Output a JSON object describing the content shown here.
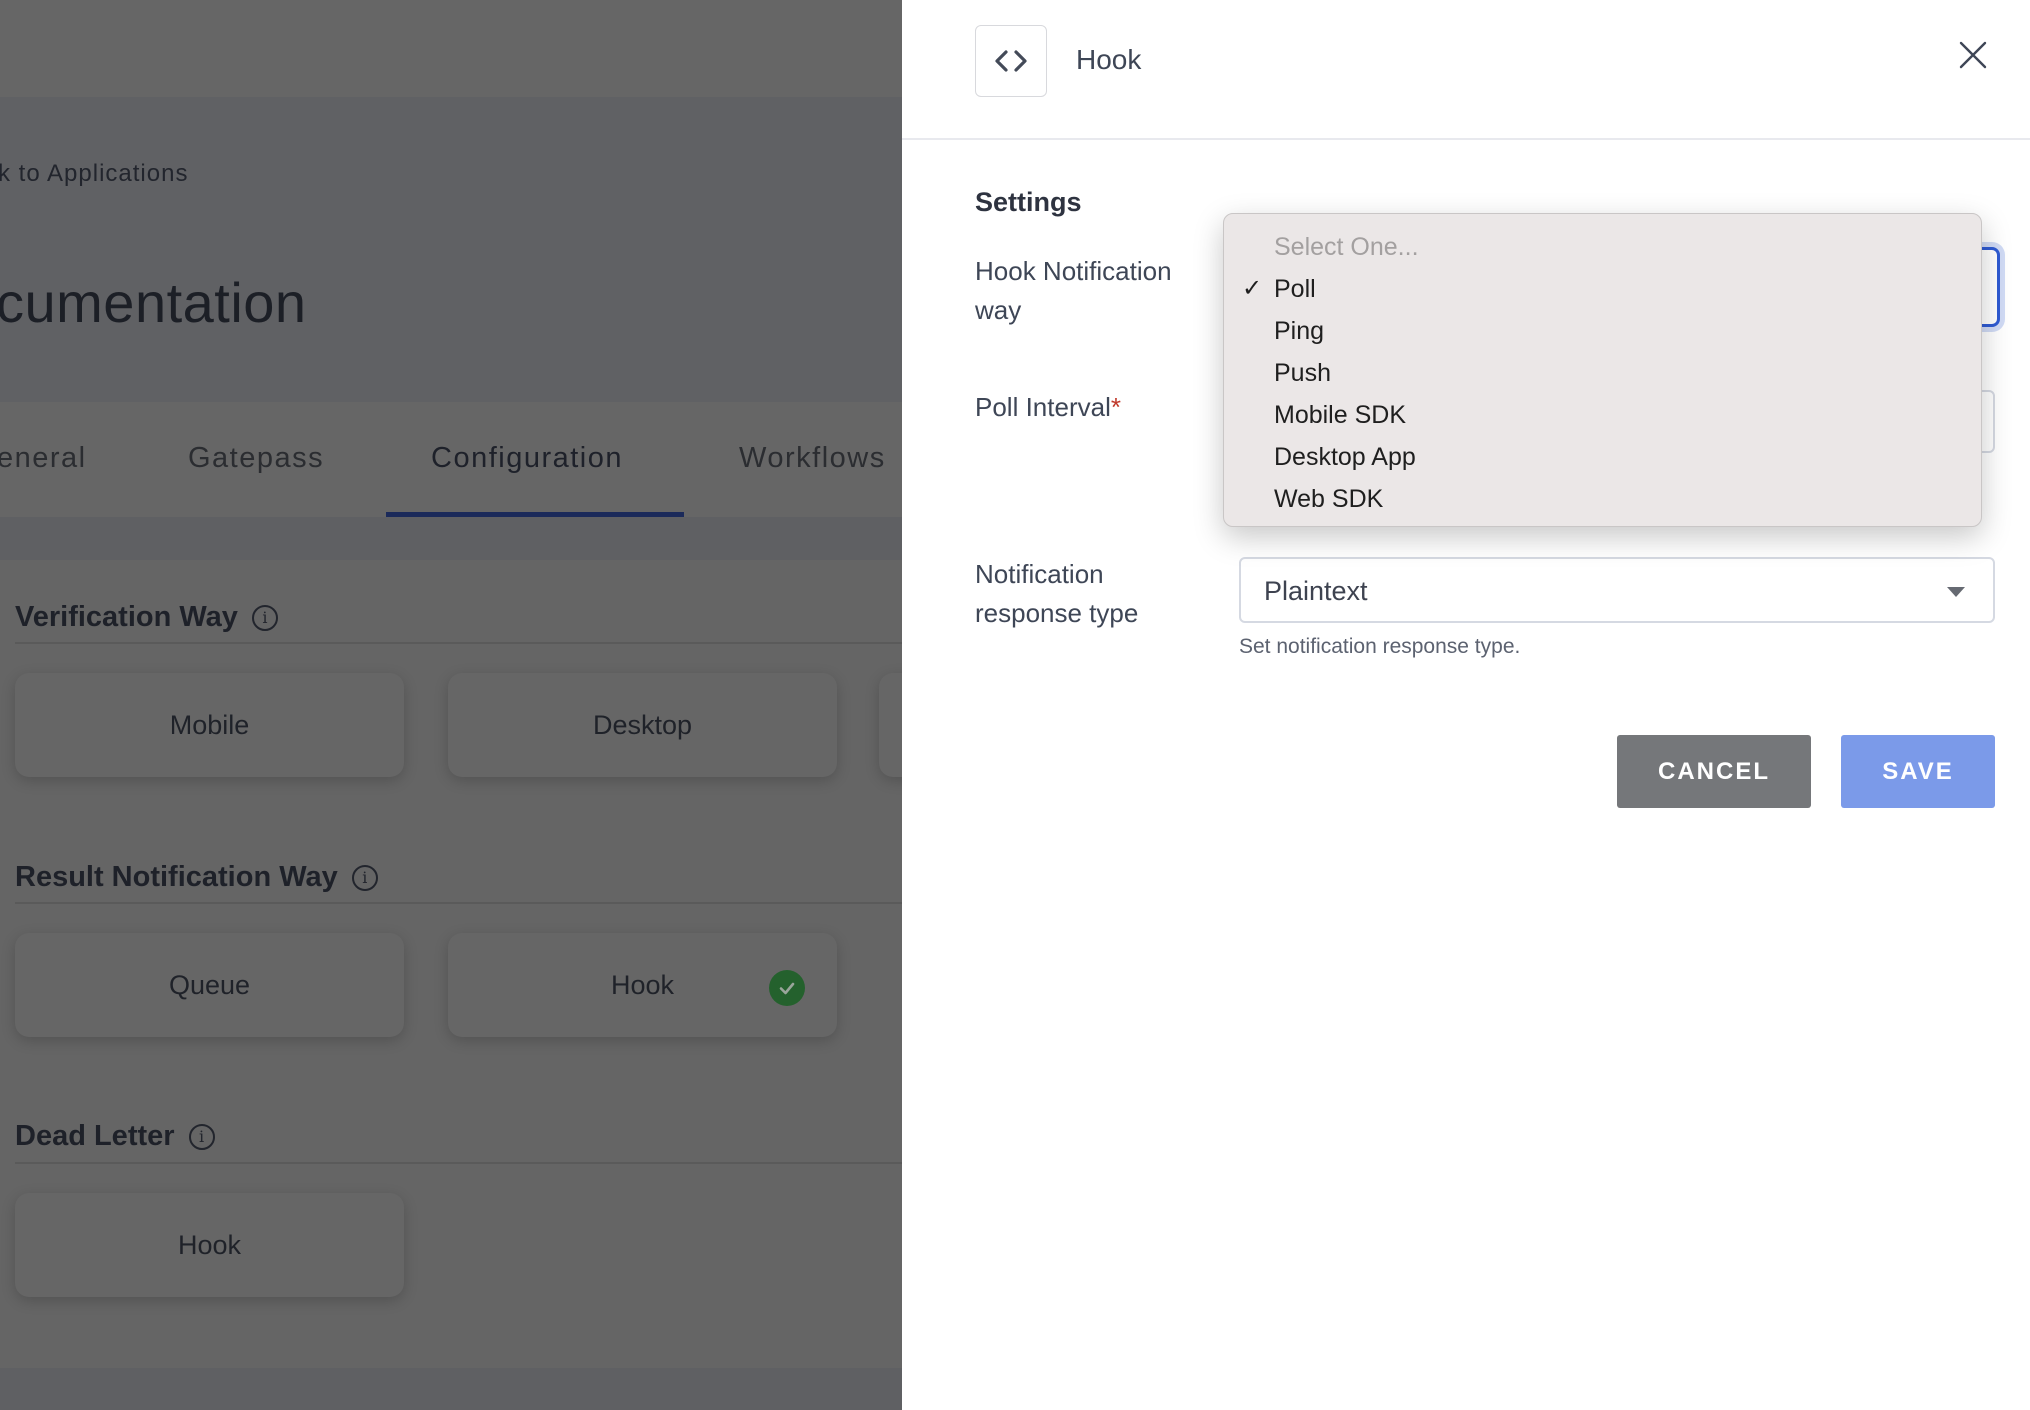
{
  "background": {
    "back_link": "k to Applications",
    "page_title": "cumentation",
    "tabs": [
      {
        "label": "eneral",
        "active": false
      },
      {
        "label": "Gatepass",
        "active": false
      },
      {
        "label": "Configuration",
        "active": true
      },
      {
        "label": "Workflows",
        "active": false
      }
    ],
    "sections": [
      {
        "heading": "Verification Way",
        "cards": [
          {
            "label": "Mobile",
            "selected": false
          },
          {
            "label": "Desktop",
            "selected": false
          },
          {
            "label": "",
            "selected": false
          }
        ]
      },
      {
        "heading": "Result Notification Way",
        "cards": [
          {
            "label": "Queue",
            "selected": false
          },
          {
            "label": "Hook",
            "selected": true
          }
        ]
      },
      {
        "heading": "Dead Letter",
        "cards": [
          {
            "label": "Hook",
            "selected": false
          }
        ]
      }
    ],
    "accent_color": "#1b2a5a",
    "selected_badge_color": "#24612d"
  },
  "panel": {
    "title": "Hook",
    "icon": "code-brackets-icon",
    "settings_heading": "Settings",
    "fields": {
      "hook_notification_way": {
        "label": "Hook Notification way",
        "value": "Poll"
      },
      "poll_interval": {
        "label": "Poll Interval",
        "required_mark": "*",
        "value": ""
      },
      "notification_response_type": {
        "label": "Notification response type",
        "value": "Plaintext",
        "helper": "Set notification response type."
      }
    },
    "buttons": {
      "cancel": "CANCEL",
      "save": "SAVE"
    },
    "colors": {
      "focus": "#2f5bd3",
      "save": "#7b9ae9",
      "cancel": "#75777a",
      "required": "#c0392b"
    }
  },
  "dropdown": {
    "placeholder": "Select One...",
    "selected": "Poll",
    "check_glyph": "✓",
    "options": [
      "Poll",
      "Ping",
      "Push",
      "Mobile SDK",
      "Desktop App",
      "Web SDK"
    ]
  }
}
